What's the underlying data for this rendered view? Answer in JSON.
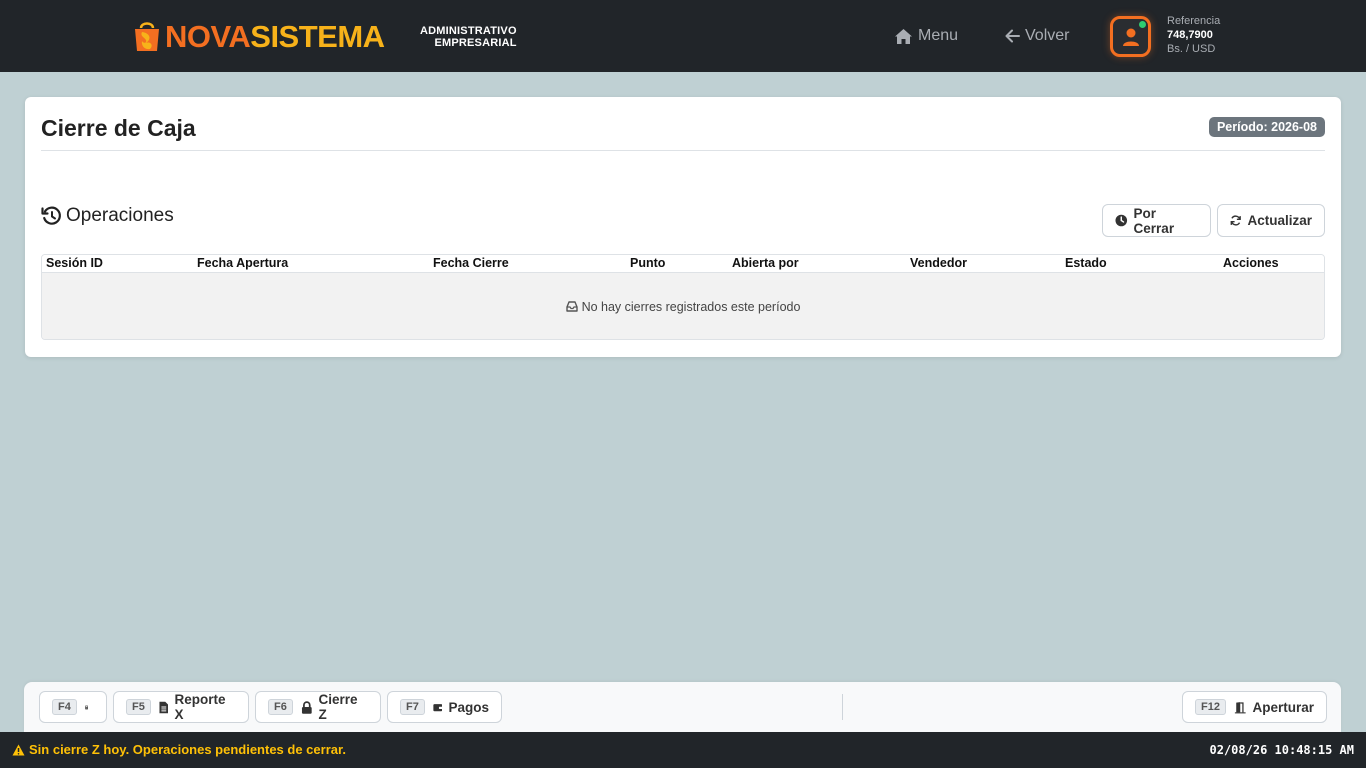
{
  "header": {
    "logo": {
      "part1": "NOVA",
      "part2": "SISTEMA"
    },
    "subtitle_line1": "ADMINISTRATIVO",
    "subtitle_line2": "EMPRESARIAL",
    "nav": {
      "menu_label": "Menu",
      "back_label": "Volver"
    },
    "reference": {
      "label": "Referencia",
      "value": "748,7900",
      "unit": "Bs. / USD"
    },
    "colors": {
      "brand_orange": "#f36f21",
      "brand_yellow": "#f7b21a",
      "online_dot": "#2ecc71"
    }
  },
  "page": {
    "title": "Cierre de Caja",
    "period_badge": "Período: 2026-08"
  },
  "operations": {
    "title": "Operaciones",
    "pending_button": "Por Cerrar",
    "refresh_button": "Actualizar",
    "table": {
      "columns": [
        "Sesión ID",
        "Fecha Apertura",
        "Fecha Cierre",
        "Punto",
        "Abierta por",
        "Vendedor",
        "Estado",
        "Acciones"
      ],
      "empty_message": "No hay cierres registrados este período"
    }
  },
  "actions": {
    "f4": {
      "key": "F4",
      "icon": "calculator-icon"
    },
    "f5": {
      "key": "F5",
      "label": "Reporte X",
      "icon": "document-icon"
    },
    "f6": {
      "key": "F6",
      "label": "Cierre Z",
      "icon": "lock-icon"
    },
    "f7": {
      "key": "F7",
      "label": "Pagos",
      "icon": "wallet-icon"
    },
    "f12": {
      "key": "F12",
      "label": "Aperturar",
      "icon": "door-icon"
    }
  },
  "status": {
    "warning": "Sin cierre Z hoy. Operaciones pendientes de cerrar.",
    "clock": "02/08/26 10:48:15 AM",
    "warning_color": "#ffc107"
  }
}
